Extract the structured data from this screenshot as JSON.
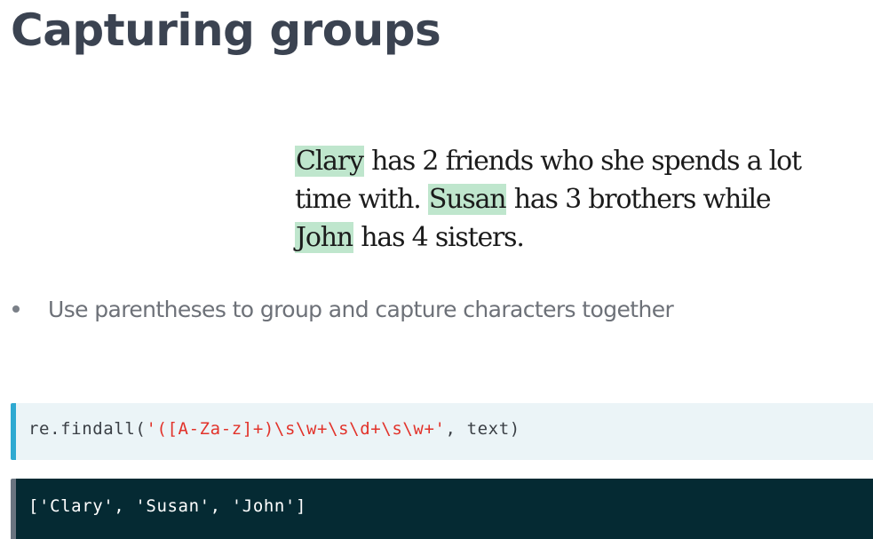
{
  "slide": {
    "title": "Capturing groups"
  },
  "example": {
    "lines": [
      [
        {
          "text": "Clary",
          "highlight": true
        },
        {
          "text": " has 2 friends who she spends a lot",
          "highlight": false
        }
      ],
      [
        {
          "text": "time with. ",
          "highlight": false
        },
        {
          "text": "Susan",
          "highlight": true
        },
        {
          "text": " has 3 brothers while",
          "highlight": false
        }
      ],
      [
        {
          "text": "John",
          "highlight": true
        },
        {
          "text": " has 4 sisters.",
          "highlight": false
        }
      ]
    ],
    "highlight_color": "#bfe6cd"
  },
  "bullets": [
    "Use parentheses to group and capture characters together"
  ],
  "code": {
    "prefix": "re.findall(",
    "pattern": "'([A-Za-z]+)\\s\\w+\\s\\d+\\s\\w+'",
    "suffix": ", text)",
    "accent_color": "#2ea9d1",
    "string_color": "#e2322a"
  },
  "output": {
    "text": "['Clary', 'Susan', 'John']"
  }
}
